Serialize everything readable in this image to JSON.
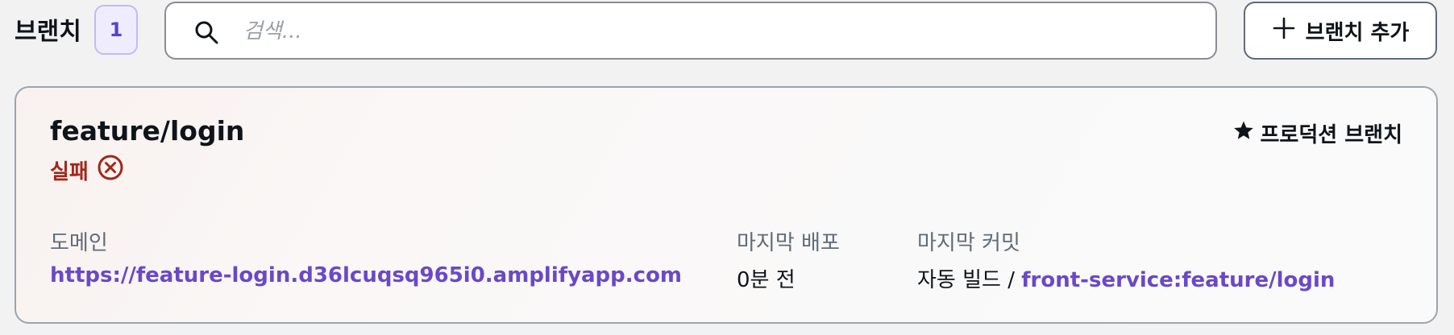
{
  "header": {
    "title": "브랜치",
    "count": "1",
    "search": {
      "placeholder": "검색...",
      "value": ""
    },
    "add_button_label": "브랜치 추가"
  },
  "branch_card": {
    "name": "feature/login",
    "status": "실패",
    "production_label": "프로덕션 브랜치",
    "domain": {
      "label": "도메인",
      "value": "https://feature-login.d36lcuqsq965i0.amplifyapp.com"
    },
    "last_deploy": {
      "label": "마지막 배포",
      "value": "0분 전"
    },
    "last_commit": {
      "label": "마지막 커밋",
      "prefix": "자동 빌드 /",
      "link": "front-service:feature/login"
    }
  },
  "colors": {
    "accent": "#6a48c8",
    "failure": "#a3261b",
    "badge_bg": "#efedfd",
    "badge_border": "#c6b8f7"
  },
  "icons": [
    "search-icon",
    "plus-icon",
    "error-circle-icon",
    "star-icon"
  ]
}
